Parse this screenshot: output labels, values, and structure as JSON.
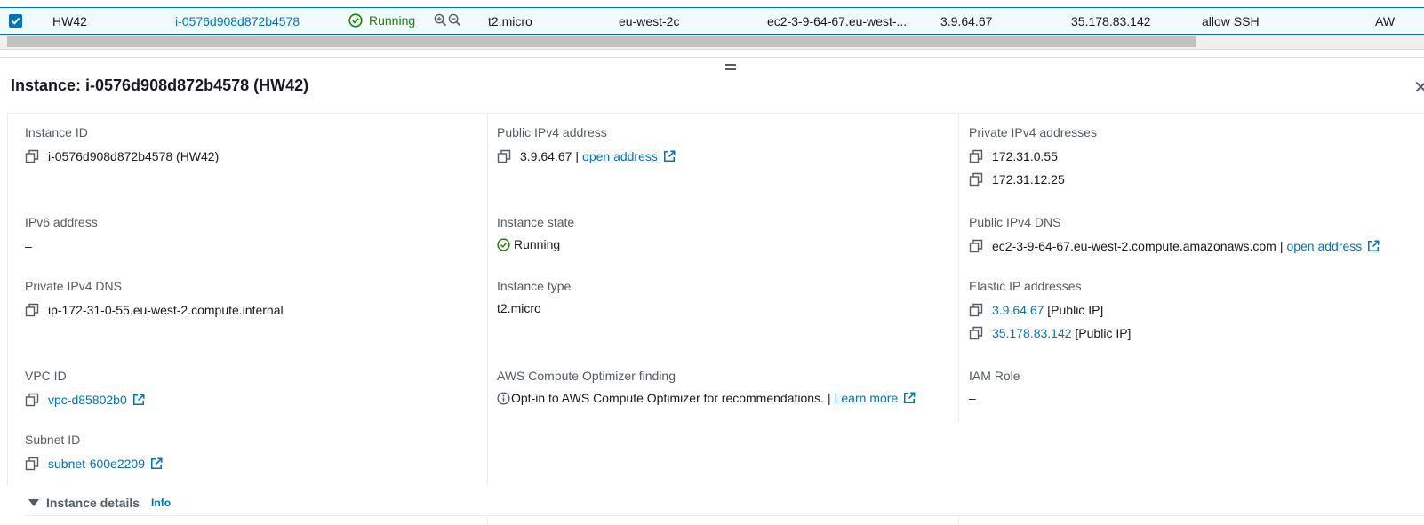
{
  "table_row": {
    "name": "HW42",
    "instance_id": "i-0576d908d872b4578",
    "state": "Running",
    "instance_type": "t2.micro",
    "availability_zone": "eu-west-2c",
    "public_dns": "ec2-3-9-64-67.eu-west-...",
    "public_ip": "3.9.64.67",
    "elastic_ip": "35.178.83.142",
    "security_group": "allow SSH",
    "overflow_col": "AW"
  },
  "panel": {
    "title": "Instance: i-0576d908d872b4578 (HW42)"
  },
  "fields": {
    "instance_id": {
      "label": "Instance ID",
      "value": "i-0576d908d872b4578 (HW42)"
    },
    "public_ipv4": {
      "label": "Public IPv4 address",
      "value": "3.9.64.67",
      "separator": "|",
      "link": "open address"
    },
    "private_ipv4": {
      "label": "Private IPv4 addresses",
      "values": [
        "172.31.0.55",
        "172.31.12.25"
      ]
    },
    "ipv6": {
      "label": "IPv6 address",
      "value": "–"
    },
    "instance_state": {
      "label": "Instance state",
      "value": "Running"
    },
    "public_dns": {
      "label": "Public IPv4 DNS",
      "value": "ec2-3-9-64-67.eu-west-2.compute.amazonaws.com",
      "separator": "|",
      "link": "open address"
    },
    "private_dns": {
      "label": "Private IPv4 DNS",
      "value": "ip-172-31-0-55.eu-west-2.compute.internal"
    },
    "instance_type": {
      "label": "Instance type",
      "value": "t2.micro"
    },
    "elastic_ip": {
      "label": "Elastic IP addresses",
      "items": [
        {
          "ip": "3.9.64.67",
          "tag": "[Public IP]"
        },
        {
          "ip": "35.178.83.142",
          "tag": "[Public IP]"
        }
      ]
    },
    "vpc_id": {
      "label": "VPC ID",
      "value": "vpc-d85802b0"
    },
    "optimizer": {
      "label": "AWS Compute Optimizer finding",
      "value": "Opt-in to AWS Compute Optimizer for recommendations.",
      "separator": "|",
      "link": "Learn more"
    },
    "iam_role": {
      "label": "IAM Role",
      "value": "–"
    },
    "subnet_id": {
      "label": "Subnet ID",
      "value": "subnet-600e2209"
    }
  },
  "section": {
    "title": "Instance details",
    "info": "Info"
  },
  "colors": {
    "link": "#0073bb",
    "running": "#1d8102",
    "selected_row_bg": "#f1faff"
  },
  "icons": [
    "checkbox-checked-icon",
    "status-running-icon",
    "zoom-in-icon",
    "zoom-out-icon",
    "copy-icon",
    "external-link-icon",
    "info-icon",
    "close-icon",
    "caret-down-icon"
  ]
}
